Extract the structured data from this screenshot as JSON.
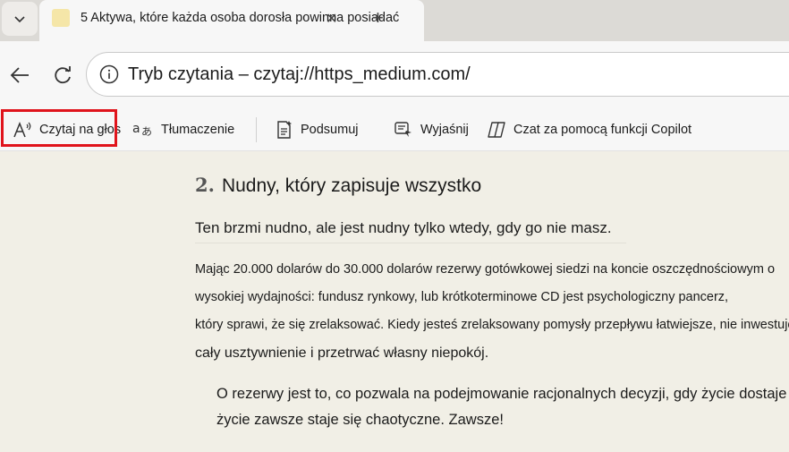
{
  "tab": {
    "title": "5 Aktywa, które każda osoba dorosła powinna posiadać",
    "favicon_color": "#f5e6a8"
  },
  "address_bar": {
    "text": "Tryb czytania – czytaj://https_medium.com/"
  },
  "toolbar": {
    "read_aloud": "Czytaj na głos",
    "translate": "Tłumaczenie",
    "summarize": "Podsumuj",
    "explain": "Wyjaśnij",
    "copilot_chat": "Czat za pomocą funkcji Copilot",
    "highlight_color": "#e0141c"
  },
  "article": {
    "heading_number": "2.",
    "heading_text": "Nudny, który zapisuje wszystko",
    "para1": "Ten brzmi nudno, ale jest nudny tylko wtedy, gdy go nie masz.",
    "para2_lines": [
      "Mając 20.000 dolarów do 30.000 dolarów rezerwy gotówkowej siedzi na koncie oszczędnościowym o",
      "wysokiej wydajności: fundusz rynkowy, lub krótkoterminowe CD jest psychologiczny pancerz,",
      "który sprawi, że się zrelaksować. Kiedy jesteś zrelaksowany pomysły przepływu łatwiejsze, nie inwestujesz",
      "cały usztywnienie i przetrwać własny niepokój."
    ],
    "quote_lines": [
      "O rezerwy jest to, co pozwala na podejmowanie racjonalnych decyzji, gdy życie dostaje",
      "życie zawsze staje się chaotyczne. Zawsze!"
    ]
  },
  "colors": {
    "reader_background": "#f1efe6",
    "chrome_background": "#f7f7f7"
  }
}
